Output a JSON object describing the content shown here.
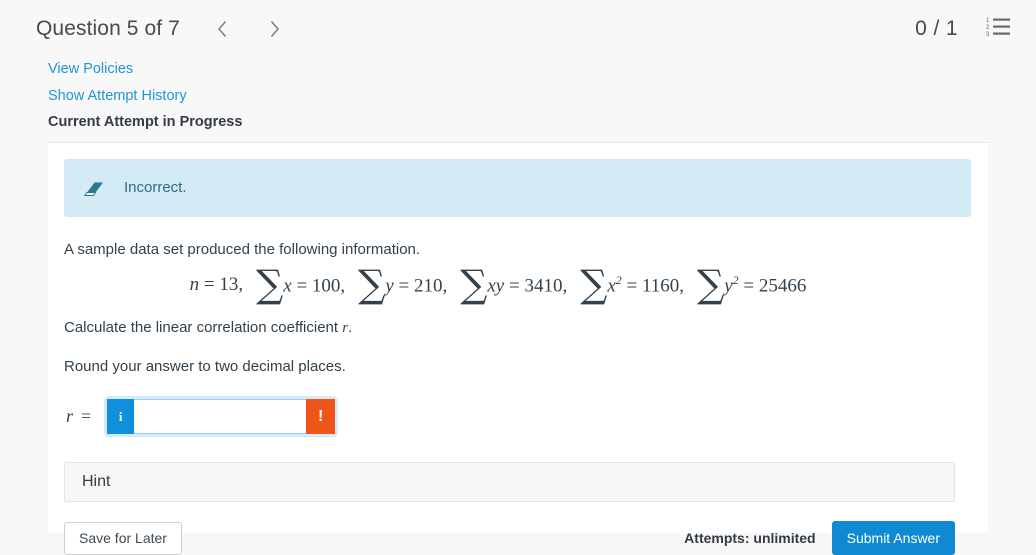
{
  "header": {
    "title": "Question 5 of 7",
    "prev_icon": "chevron-left-icon",
    "next_icon": "chevron-right-icon",
    "score": "0 / 1",
    "list_icon": "numbered-list-icon"
  },
  "links": {
    "view_policies": "View Policies",
    "show_attempt_history": "Show Attempt History",
    "attempt_status": "Current Attempt in Progress"
  },
  "banner": {
    "icon": "eraser-icon",
    "text": "Incorrect.",
    "background": "#d2ebf5",
    "text_color": "#35697f"
  },
  "question": {
    "intro": "A sample data set produced the following information.",
    "math": {
      "n_label": "n",
      "n_eq": " =  13, ",
      "terms": [
        {
          "sum": "∑",
          "var": "x",
          "exp": "",
          "eq": " =  100, "
        },
        {
          "sum": "∑",
          "var": "y",
          "exp": "",
          "eq": " =  210, "
        },
        {
          "sum": "∑",
          "var": "xy",
          "exp": "",
          "eq": " =  3410, "
        },
        {
          "sum": "∑",
          "var": "x",
          "exp": "2",
          "eq": " =  1160, "
        },
        {
          "sum": "∑",
          "var": "y",
          "exp": "2",
          "eq": " =  25466"
        }
      ]
    },
    "instruction_1_pre": "Calculate the linear correlation coefficient ",
    "instruction_1_var": "r",
    "instruction_1_post": ".",
    "instruction_2": "Round your answer to two decimal places."
  },
  "answer": {
    "label": "r",
    "equals": "=",
    "info_badge": "i",
    "alert_badge": "!",
    "value": "",
    "placeholder": "",
    "info_color": "#0f90dd",
    "alert_color": "#ef5518"
  },
  "hint": {
    "label": "Hint"
  },
  "footer": {
    "save_label": "Save for Later",
    "attempts": "Attempts: unlimited",
    "submit_label": "Submit Answer",
    "submit_color": "#1089d3"
  }
}
